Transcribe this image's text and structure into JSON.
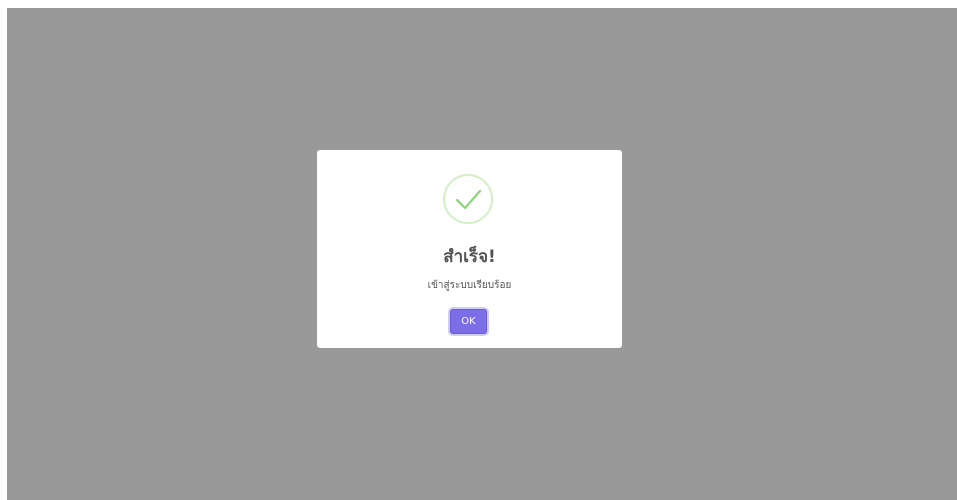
{
  "dialog": {
    "icon": "checkmark-success-icon",
    "title": "สำเร็จ!",
    "message": "เข้าสู่ระบบเรียบร้อย",
    "ok_label": "OK"
  },
  "colors": {
    "overlay": "#999999",
    "modal_bg": "#ffffff",
    "icon_ring": "#d3efc6",
    "icon_check": "#8ed47a",
    "button_bg": "#7c6ee6",
    "text": "#545454"
  }
}
